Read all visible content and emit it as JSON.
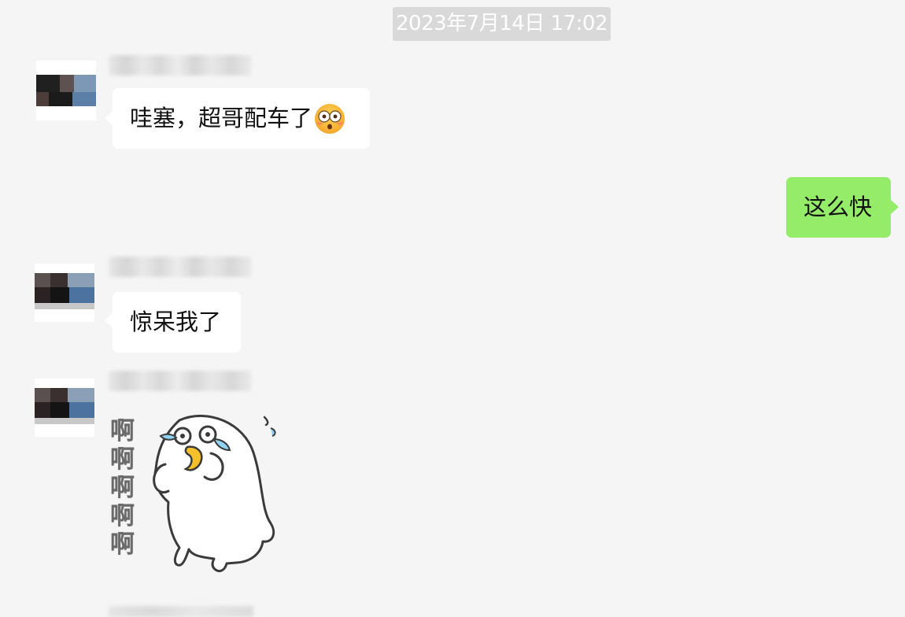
{
  "chat": {
    "timestamp": "2023年7月14日 17:02",
    "messages": [
      {
        "side": "left",
        "text": "哇塞，超哥配车了",
        "emoji": "flushed-face-icon"
      },
      {
        "side": "right",
        "text": "这么快"
      },
      {
        "side": "left",
        "text": "惊呆我了"
      },
      {
        "side": "left",
        "type": "sticker",
        "sticker_text": [
          "啊",
          "啊",
          "啊",
          "啊",
          "啊"
        ],
        "sticker_name": "crying-seal-sticker"
      }
    ]
  },
  "colors": {
    "background": "#f5f5f5",
    "bubble_left": "#ffffff",
    "bubble_right": "#95ec69",
    "timestamp_bg": "#d9d9d9",
    "timestamp_text": "#ffffff"
  }
}
